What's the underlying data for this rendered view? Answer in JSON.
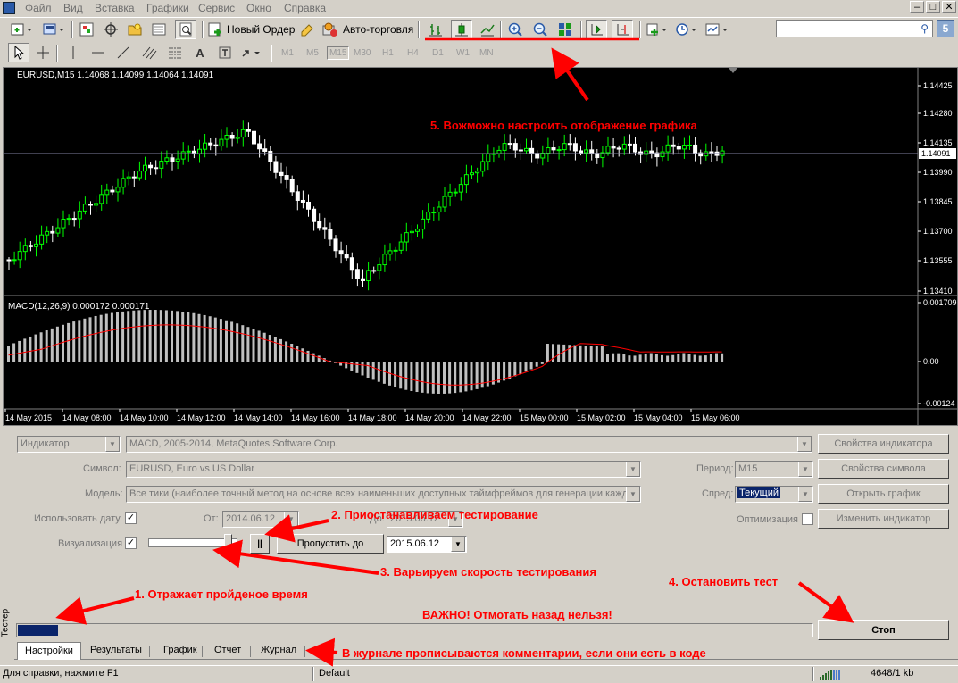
{
  "menu": [
    "Файл",
    "Вид",
    "Вставка",
    "Графики",
    "Сервис",
    "Окно",
    "Справка"
  ],
  "window_controls": [
    "–",
    "□",
    "✕"
  ],
  "toolbar1": {
    "new_order_label": "Новый Ордер",
    "autotrade_label": "Авто-торговля",
    "search_placeholder": "",
    "search_badge": "5"
  },
  "toolbar2": {
    "text_tool": "A",
    "timeframes": [
      "M1",
      "M5",
      "M15",
      "M30",
      "H1",
      "H4",
      "D1",
      "W1",
      "MN"
    ],
    "active_timeframe": "M15"
  },
  "chart": {
    "header": "EURUSD,M15  1.14068 1.14099 1.14064 1.14091",
    "current_price": "1.14091",
    "price_axis": [
      "1.14425",
      "1.14280",
      "1.14135",
      "1.13990",
      "1.13845",
      "1.13700",
      "1.13555",
      "1.13410"
    ],
    "macd_header": "MACD(12,26,9) 0.000172 0.000171",
    "macd_axis": [
      "0.001709",
      "0.00",
      "-0.00124"
    ],
    "time_axis": [
      "14 May 2015",
      "14 May 08:00",
      "14 May 10:00",
      "14 May 12:00",
      "14 May 14:00",
      "14 May 16:00",
      "14 May 18:00",
      "14 May 20:00",
      "14 May 22:00",
      "15 May 00:00",
      "15 May 02:00",
      "15 May 04:00",
      "15 May 06:00"
    ],
    "colors": {
      "bull": "#00ff00",
      "bear": "#ffffff",
      "signal": "#ff0000",
      "histogram": "#c0c0c0",
      "bid_line": "#7f7fa0"
    }
  },
  "tester": {
    "side_label": "Тестер",
    "expert_type": "Индикатор",
    "expert_name": "MACD, 2005-2014, MetaQuotes Software Corp.",
    "symbol_label": "Символ:",
    "symbol_value": "EURUSD, Euro vs US Dollar",
    "model_label": "Модель:",
    "model_value": "Все тики (наиболее точный метод на основе всех наименьших доступных таймфреймов для генерации кажд",
    "use_date_label": "Использовать дату",
    "use_date_checked": "✓",
    "from_label": "От:",
    "from_value": "2014.06.12",
    "to_label": "До:",
    "to_value": "2015.06.12",
    "visual_label": "Визуализация",
    "visual_checked": "✓",
    "speed_percent": 90,
    "pause_label": "||",
    "skip_label": "Пропустить до",
    "skip_date": "2015.06.12",
    "period_label": "Период:",
    "period_value": "M15",
    "spread_label": "Спред:",
    "spread_value": "Текущий",
    "optimization_label": "Оптимизация",
    "btn_indicator_props": "Свойства индикатора",
    "btn_symbol_props": "Свойства символа",
    "btn_open_chart": "Открыть график",
    "btn_modify_indicator": "Изменить индикатор",
    "progress_percent": 5,
    "stop_label": "Стоп",
    "tabs": [
      "Настройки",
      "Результаты",
      "График",
      "Отчет",
      "Журнал"
    ],
    "active_tab": "Настройки"
  },
  "status": {
    "help": "Для справки, нажмите F1",
    "profile": "Default",
    "traffic": "4648/1 kb"
  },
  "annotations": {
    "a1": "1. Отражает пройденое время",
    "a2": "2. Приостанавливаем тестирование",
    "a3": "3. Варьируем скорость тестирования",
    "a4": "4. Остановить тест",
    "a5": "5. Вожможно настроить отображение графика",
    "important": "ВАЖНО! Отмотать назад нельзя!",
    "journal": "В журнале прописываются комментарии, если они есть в коде"
  }
}
